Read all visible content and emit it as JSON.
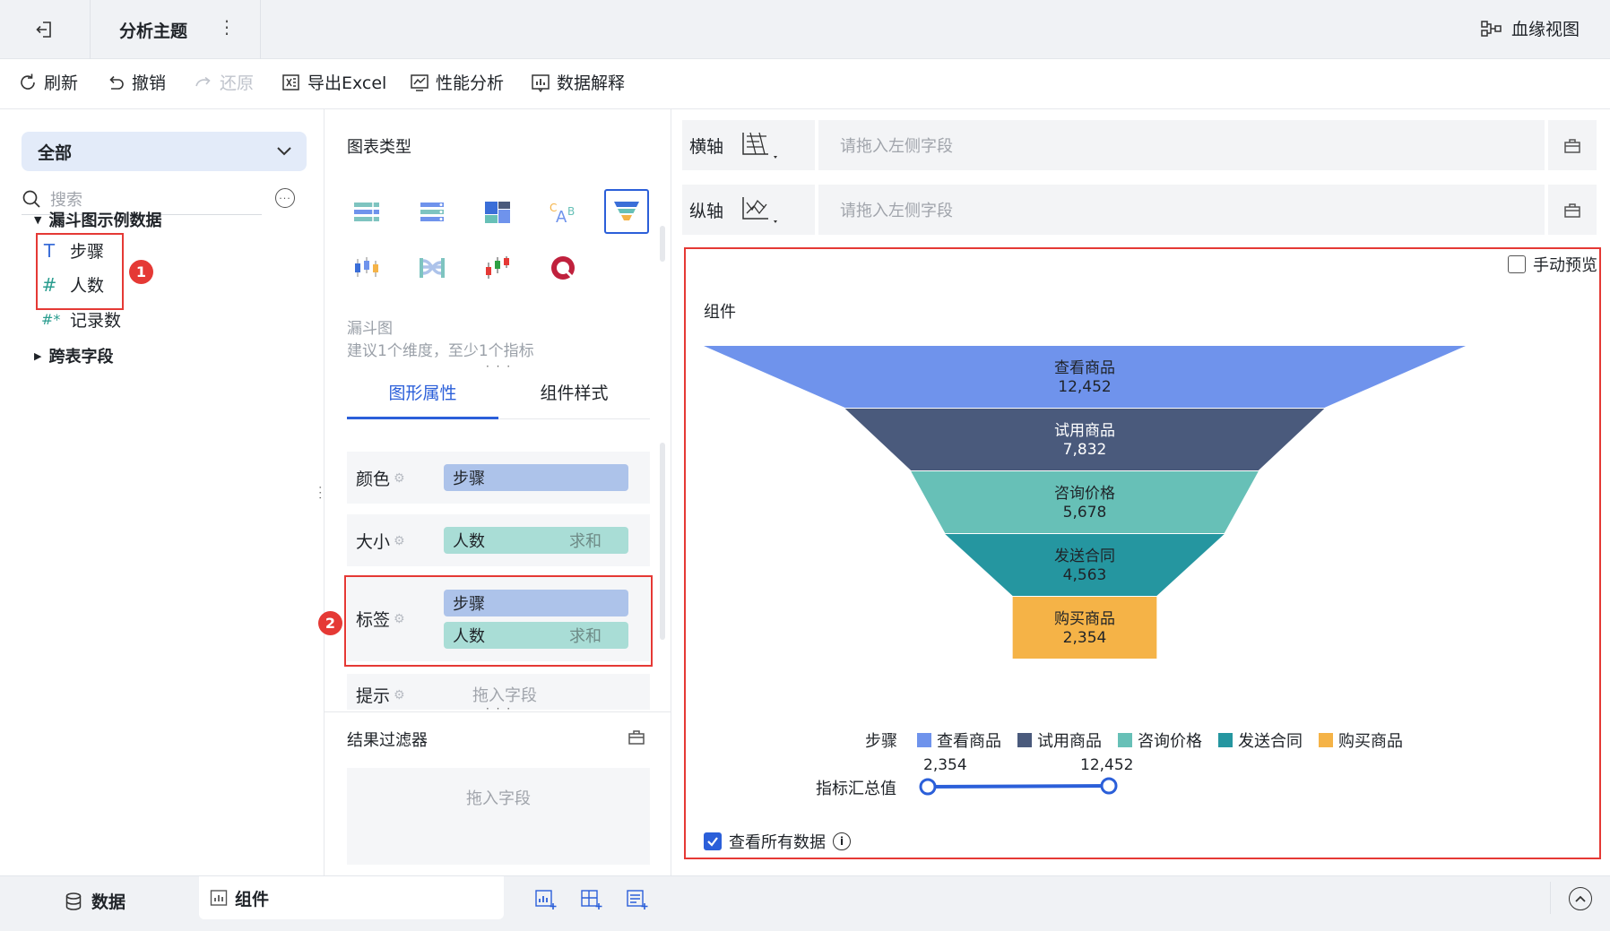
{
  "topbar": {
    "title": "分析主题",
    "more": "⋮",
    "lineage_label": "血缘视图"
  },
  "toolbar": {
    "refresh": "刷新",
    "undo": "撤销",
    "redo": "还原",
    "export": "导出Excel",
    "perf": "性能分析",
    "explain": "数据解释"
  },
  "left": {
    "scope": "全部",
    "search_placeholder": "搜索",
    "group1": "漏斗图示例数据",
    "fields": [
      {
        "icon": "T",
        "label": "步骤"
      },
      {
        "icon": "#",
        "label": "人数"
      },
      {
        "icon": "#*",
        "label": "记录数"
      }
    ],
    "group2": "跨表字段",
    "badge1": "1"
  },
  "mid": {
    "chart_type_title": "图表类型",
    "chart_name": "漏斗图",
    "chart_hint": "建议1个维度，至少1个指标",
    "tab_props": "图形属性",
    "tab_style": "组件样式",
    "color_label": "颜色",
    "color_field": "步骤",
    "size_label": "大小",
    "size_field": "人数",
    "size_agg": "求和",
    "tag_label": "标签",
    "tag_field1": "步骤",
    "tag_field2": "人数",
    "tag_agg": "求和",
    "tip_label": "提示",
    "tip_placeholder": "拖入字段",
    "badge2": "2",
    "filter_title": "结果过滤器",
    "filter_placeholder": "拖入字段"
  },
  "axes": {
    "x_label": "横轴",
    "x_placeholder": "请拖入左侧字段",
    "y_label": "纵轴",
    "y_placeholder": "请拖入左侧字段"
  },
  "preview": {
    "manual_preview": "手动预览",
    "component_label": "组件",
    "legend_title": "步骤",
    "range_title": "指标汇总值",
    "range_min": "2,354",
    "range_max": "12,452",
    "all_data": "查看所有数据"
  },
  "chart_data": {
    "type": "funnel",
    "categories": [
      "查看商品",
      "试用商品",
      "咨询价格",
      "发送合同",
      "购买商品"
    ],
    "values": [
      12452,
      7832,
      5678,
      4563,
      2354
    ],
    "labels": [
      "12,452",
      "7,832",
      "5,678",
      "4,563",
      "2,354"
    ],
    "colors": [
      "#6f93ec",
      "#4a5a7c",
      "#67c0b7",
      "#2596a0",
      "#f5b347"
    ],
    "legend": "bottom"
  },
  "bottom": {
    "tab_data": "数据",
    "tab_component": "组件"
  },
  "colors": {
    "accent": "#2b5fd9",
    "highlight": "#e53935"
  }
}
